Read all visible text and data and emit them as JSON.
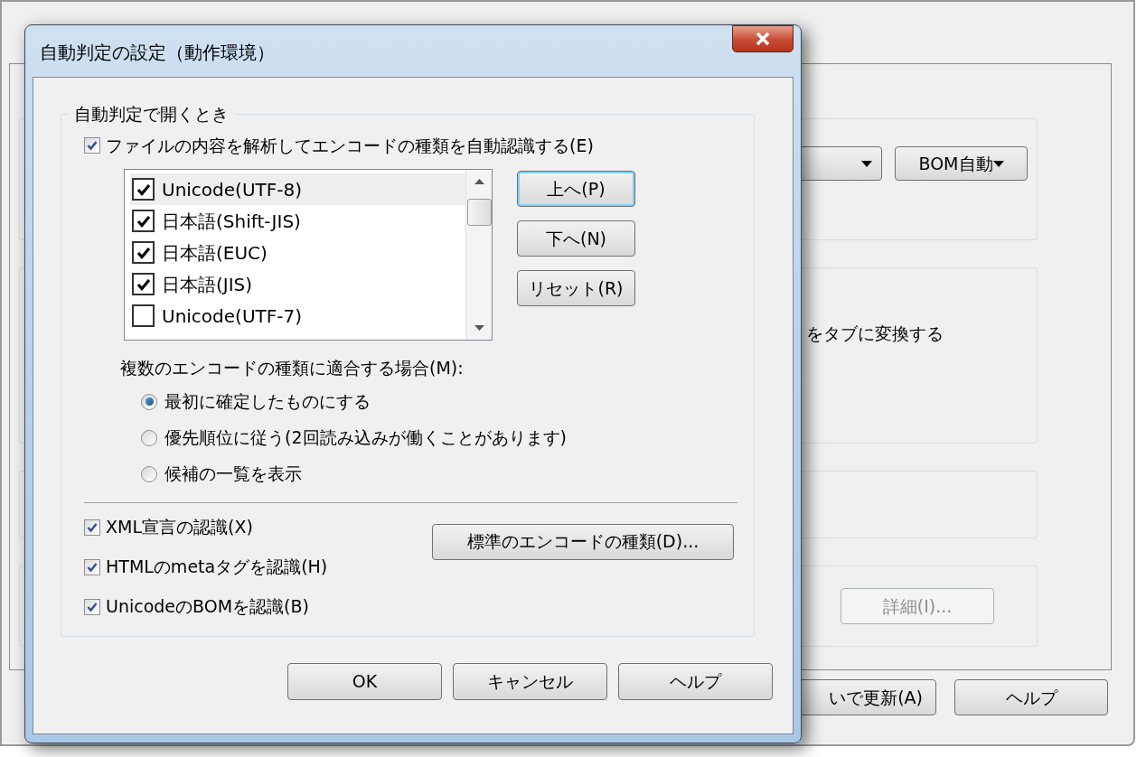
{
  "background_window": {
    "encoding_dropdown": {
      "value": "BOM自動"
    },
    "tab_conversion_text": "をタブに変換する",
    "details_button": {
      "label": "詳細(I)...",
      "disabled": true
    },
    "buttons": [
      "いで更新(A)",
      "ヘルプ"
    ]
  },
  "dialog": {
    "title": "自動判定の設定（動作環境）",
    "group_title": "自動判定で開くとき",
    "auto_detect": {
      "label": "ファイルの内容を解析してエンコードの種類を自動認識する(E)",
      "checked": true
    },
    "encodings": [
      {
        "label": "Unicode(UTF-8)",
        "checked": true,
        "selected": true
      },
      {
        "label": "日本語(Shift-JIS)",
        "checked": true,
        "selected": false
      },
      {
        "label": "日本語(EUC)",
        "checked": true,
        "selected": false
      },
      {
        "label": "日本語(JIS)",
        "checked": true,
        "selected": false
      },
      {
        "label": "Unicode(UTF-7)",
        "checked": false,
        "selected": false
      }
    ],
    "order_buttons": [
      {
        "label": "上へ(P)",
        "focused": true
      },
      {
        "label": "下へ(N)",
        "focused": false
      },
      {
        "label": "リセット(R)",
        "focused": false
      }
    ],
    "multi_match": {
      "label": "複数のエンコードの種類に適合する場合(M):",
      "options": [
        {
          "label": "最初に確定したものにする",
          "selected": true
        },
        {
          "label": "優先順位に従う(2回読み込みが働くことがあります)",
          "selected": false
        },
        {
          "label": "候補の一覧を表示",
          "selected": false
        }
      ]
    },
    "recognize": [
      {
        "label": "XML宣言の認識(X)",
        "checked": true
      },
      {
        "label": "HTMLのmetaタグを認識(H)",
        "checked": true
      },
      {
        "label": "UnicodeのBOMを認識(B)",
        "checked": true
      }
    ],
    "default_encoding_button": "標準のエンコードの種類(D)...",
    "buttons": [
      "OK",
      "キャンセル",
      "ヘルプ"
    ]
  }
}
